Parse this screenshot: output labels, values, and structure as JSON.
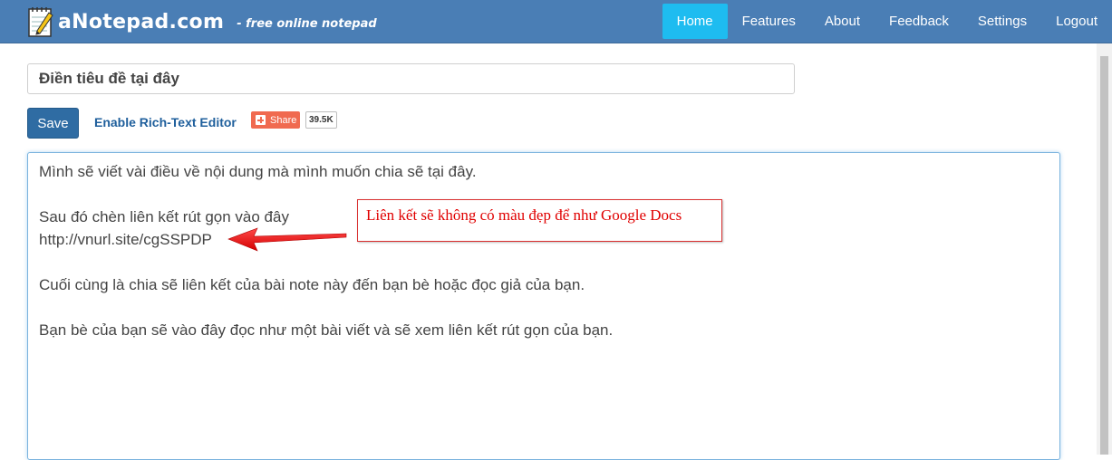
{
  "brand": {
    "name": "aNotepad.com",
    "tagline": "- free online notepad"
  },
  "nav": {
    "items": [
      {
        "label": "Home",
        "active": true
      },
      {
        "label": "Features"
      },
      {
        "label": "About"
      },
      {
        "label": "Feedback"
      },
      {
        "label": "Settings"
      },
      {
        "label": "Logout"
      }
    ]
  },
  "note": {
    "title_placeholder": "Điền tiêu đề tại đây",
    "save_label": "Save",
    "rich_text_label": "Enable Rich-Text Editor",
    "share_label": "Share",
    "share_count": "39.5K",
    "lines": [
      "Mình sẽ viết vài điều về nội dung mà mình muốn chia sẽ tại đây.",
      "",
      "Sau đó chèn liên kết rút gọn vào đây",
      "http://vnurl.site/cgSSPDP",
      "",
      "Cuối cùng là chia sẽ liên kết của bài note này đến bạn bè hoặc đọc giả của bạn.",
      "",
      "Bạn bè của bạn sẽ vào đây đọc như một bài viết và sẽ xem liên kết rút gọn của bạn."
    ]
  },
  "annotation": {
    "text": "Liên kết sẽ không có màu đẹp để như Google Docs"
  },
  "colors": {
    "navbar": "#4a7eb5",
    "nav_active": "#1ebcf0",
    "save_button": "#2f6ca3",
    "share_button": "#f06a50",
    "annotation": "#e00000"
  }
}
